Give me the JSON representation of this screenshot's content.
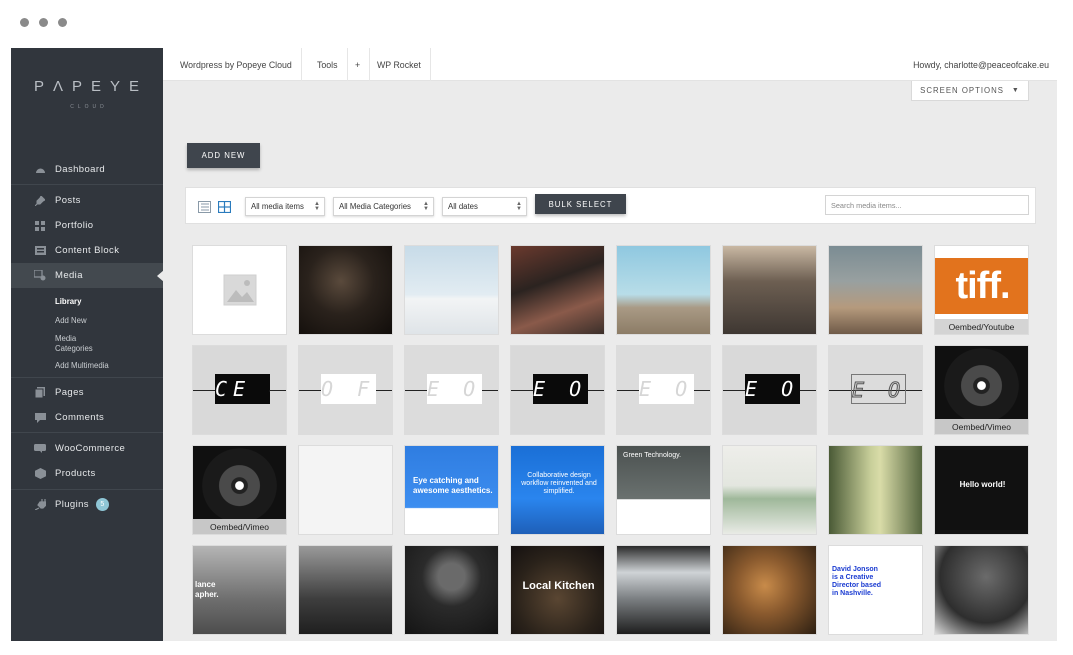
{
  "window": {
    "controls": [
      "dot",
      "dot",
      "dot"
    ]
  },
  "brand": {
    "logo_text": "PΛPEYE",
    "logo_sub": "CLOUD"
  },
  "sidebar": {
    "items": [
      {
        "label": "Dashboard",
        "icon": "dashboard-icon"
      },
      {
        "label": "Posts",
        "icon": "pin-icon"
      },
      {
        "label": "Portfolio",
        "icon": "grid-icon"
      },
      {
        "label": "Content Block",
        "icon": "block-icon"
      },
      {
        "label": "Media",
        "icon": "media-icon",
        "active": true
      },
      {
        "label": "Pages",
        "icon": "pages-icon"
      },
      {
        "label": "Comments",
        "icon": "comment-icon"
      },
      {
        "label": "WooCommerce",
        "icon": "woo-icon"
      },
      {
        "label": "Products",
        "icon": "box-icon"
      },
      {
        "label": "Plugins",
        "icon": "plug-icon",
        "badge": "5"
      }
    ],
    "media_submenu": [
      "Library",
      "Add New",
      "Media Categories",
      "Add Multimedia"
    ]
  },
  "topbar": {
    "items": [
      "Wordpress by Popeye Cloud",
      "Tools",
      "+",
      "WP Rocket"
    ],
    "user": "Howdy, charlotte@peaceofcake.eu"
  },
  "screen_options": {
    "label": "SCREEN OPTIONS",
    "caret": "▼"
  },
  "add_new": "ADD NEW",
  "filters": {
    "type": "All media items",
    "category": "All Media Categories",
    "date": "All dates",
    "bulk": "BULK SELECT",
    "search_placeholder": "Search media items..."
  },
  "tiles": [
    {
      "kind": "placeholder",
      "caption": ""
    },
    {
      "kind": "photo-dark",
      "caption": ""
    },
    {
      "kind": "photo-sky",
      "caption": ""
    },
    {
      "kind": "photo-shop",
      "caption": ""
    },
    {
      "kind": "photo-yellow",
      "caption": ""
    },
    {
      "kind": "photo-street",
      "caption": ""
    },
    {
      "kind": "photo-girl",
      "caption": ""
    },
    {
      "kind": "tiff",
      "caption": "Oembed/Youtube",
      "text": "tiff."
    },
    {
      "kind": "video-frame",
      "caption": "",
      "text": "CE OF CA"
    },
    {
      "kind": "video-frame-light",
      "caption": "",
      "text": "O F C"
    },
    {
      "kind": "video-frame-light",
      "caption": "",
      "text": "E O F"
    },
    {
      "kind": "video-frame",
      "caption": "",
      "text": "E O F C"
    },
    {
      "kind": "video-frame-light",
      "caption": "",
      "text": "E O F"
    },
    {
      "kind": "video-frame",
      "caption": "",
      "text": "E O F"
    },
    {
      "kind": "video-frame-outline",
      "caption": "",
      "text": "E O F"
    },
    {
      "kind": "vinyl",
      "caption": "Oembed/Vimeo"
    },
    {
      "kind": "vinyl",
      "caption": "Oembed/Vimeo"
    },
    {
      "kind": "web-white",
      "caption": ""
    },
    {
      "kind": "web-blue",
      "caption": "",
      "text": "Eye catching and awesome aesthetics."
    },
    {
      "kind": "web-blue2",
      "caption": "",
      "text": "Collaborative design workflow reinvented and simplified."
    },
    {
      "kind": "web-green",
      "caption": "",
      "text": "Green Technology."
    },
    {
      "kind": "photo-plants",
      "caption": ""
    },
    {
      "kind": "photo-forest",
      "caption": ""
    },
    {
      "kind": "web-black",
      "caption": "",
      "text": "Hello world!"
    },
    {
      "kind": "photo-camera-gray",
      "caption": "",
      "text": "lance apher."
    },
    {
      "kind": "photo-camera-dark",
      "caption": ""
    },
    {
      "kind": "photo-portrait",
      "caption": ""
    },
    {
      "kind": "photo-kitchen",
      "caption": "",
      "text": "Local Kitchen"
    },
    {
      "kind": "photo-window",
      "caption": ""
    },
    {
      "kind": "photo-lion",
      "caption": ""
    },
    {
      "kind": "web-david",
      "caption": "",
      "text": "David Jonson is a Creative Director based in Nashville."
    },
    {
      "kind": "photo-boxer",
      "caption": ""
    }
  ],
  "colors": {
    "sidebar": "#31363d",
    "accent_button": "#3f454d",
    "content_bg": "#ebebeb"
  }
}
